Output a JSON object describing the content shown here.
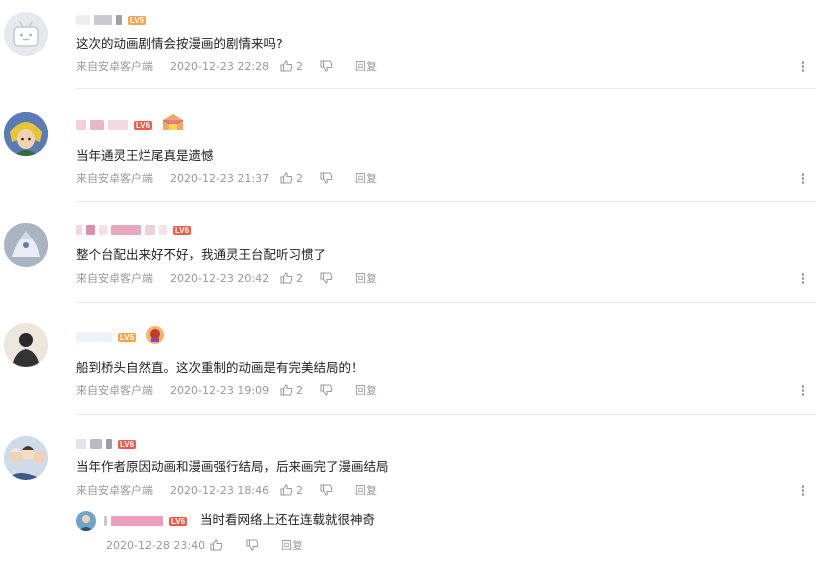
{
  "comments": [
    {
      "text": "这次的动画剧情会按漫画的剧情来吗?",
      "source": "来自安卓客户端",
      "time": "2020-12-23 22:28",
      "likes": "2",
      "reply_label": "回复",
      "level": "LV5"
    },
    {
      "text": "当年通灵王烂尾真是遗憾",
      "source": "来自安卓客户端",
      "time": "2020-12-23 21:37",
      "likes": "2",
      "reply_label": "回复",
      "level": "LV6"
    },
    {
      "text": "整个台配出来好不好，我通灵王台配听习惯了",
      "source": "来自安卓客户端",
      "time": "2020-12-23 20:42",
      "likes": "2",
      "reply_label": "回复",
      "level": "LV6"
    },
    {
      "text": "船到桥头自然直。这次重制的动画是有完美结局的！",
      "source": "来自安卓客户端",
      "time": "2020-12-23 19:09",
      "likes": "2",
      "reply_label": "回复",
      "level": "LV5"
    },
    {
      "text": "当年作者原因动画和漫画强行结局，后来画完了漫画结局",
      "source": "来自安卓客户端",
      "time": "2020-12-23 18:46",
      "likes": "2",
      "reply_label": "回复",
      "level": "LV6",
      "sub_reply": {
        "text": "当时看网络上还在连载就很神奇",
        "time": "2020-12-28 23:40",
        "reply_label": "回复",
        "level": "LV6"
      }
    }
  ],
  "colors": {
    "level5": "#f7a350",
    "level6": "#ee5c4a",
    "meta_text": "#999999",
    "blur_gray": "#c8c8cc",
    "blur_pink": "#f3c6d6"
  }
}
